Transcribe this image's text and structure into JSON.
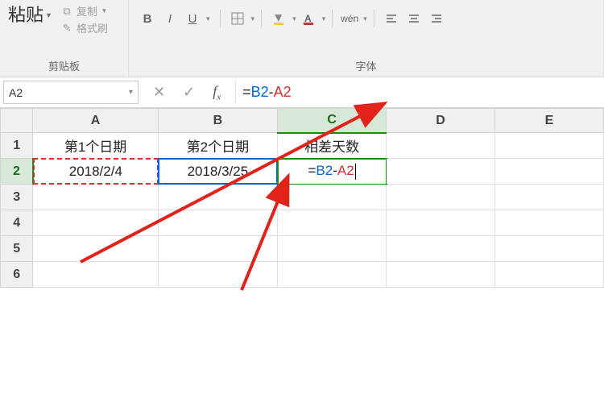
{
  "ribbon": {
    "clipboard": {
      "paste_label": "粘贴",
      "copy_label": "复制",
      "format_painter_label": "格式刷",
      "group_label": "剪贴板"
    },
    "font": {
      "group_label": "字体",
      "bold": "B",
      "italic": "I",
      "underline": "U",
      "wen": "wén"
    }
  },
  "name_box": {
    "value": "A2"
  },
  "formula_bar": {
    "cancel": "✕",
    "enter": "✓",
    "fx_label": "fx",
    "value": "=B2-A2",
    "eq": "=",
    "ref1": "B2",
    "minus": "-",
    "ref2": "A2"
  },
  "grid": {
    "col_headers": [
      "A",
      "B",
      "C",
      "D",
      "E"
    ],
    "row_headers": [
      "1",
      "2",
      "3",
      "4",
      "5",
      "6"
    ],
    "cells": {
      "A1": "第1个日期",
      "B1": "第2个日期",
      "C1": "相差天数",
      "A2": "2018/2/4",
      "B2": "2018/3/25",
      "C2_eq": "=",
      "C2_ref1": "B2",
      "C2_minus": "-",
      "C2_ref2": "A2"
    }
  },
  "colors": {
    "accent": "#1a8a1a",
    "arrow": "#e2231a",
    "blue_ref": "#0066d6",
    "red_ref": "#d03030"
  }
}
